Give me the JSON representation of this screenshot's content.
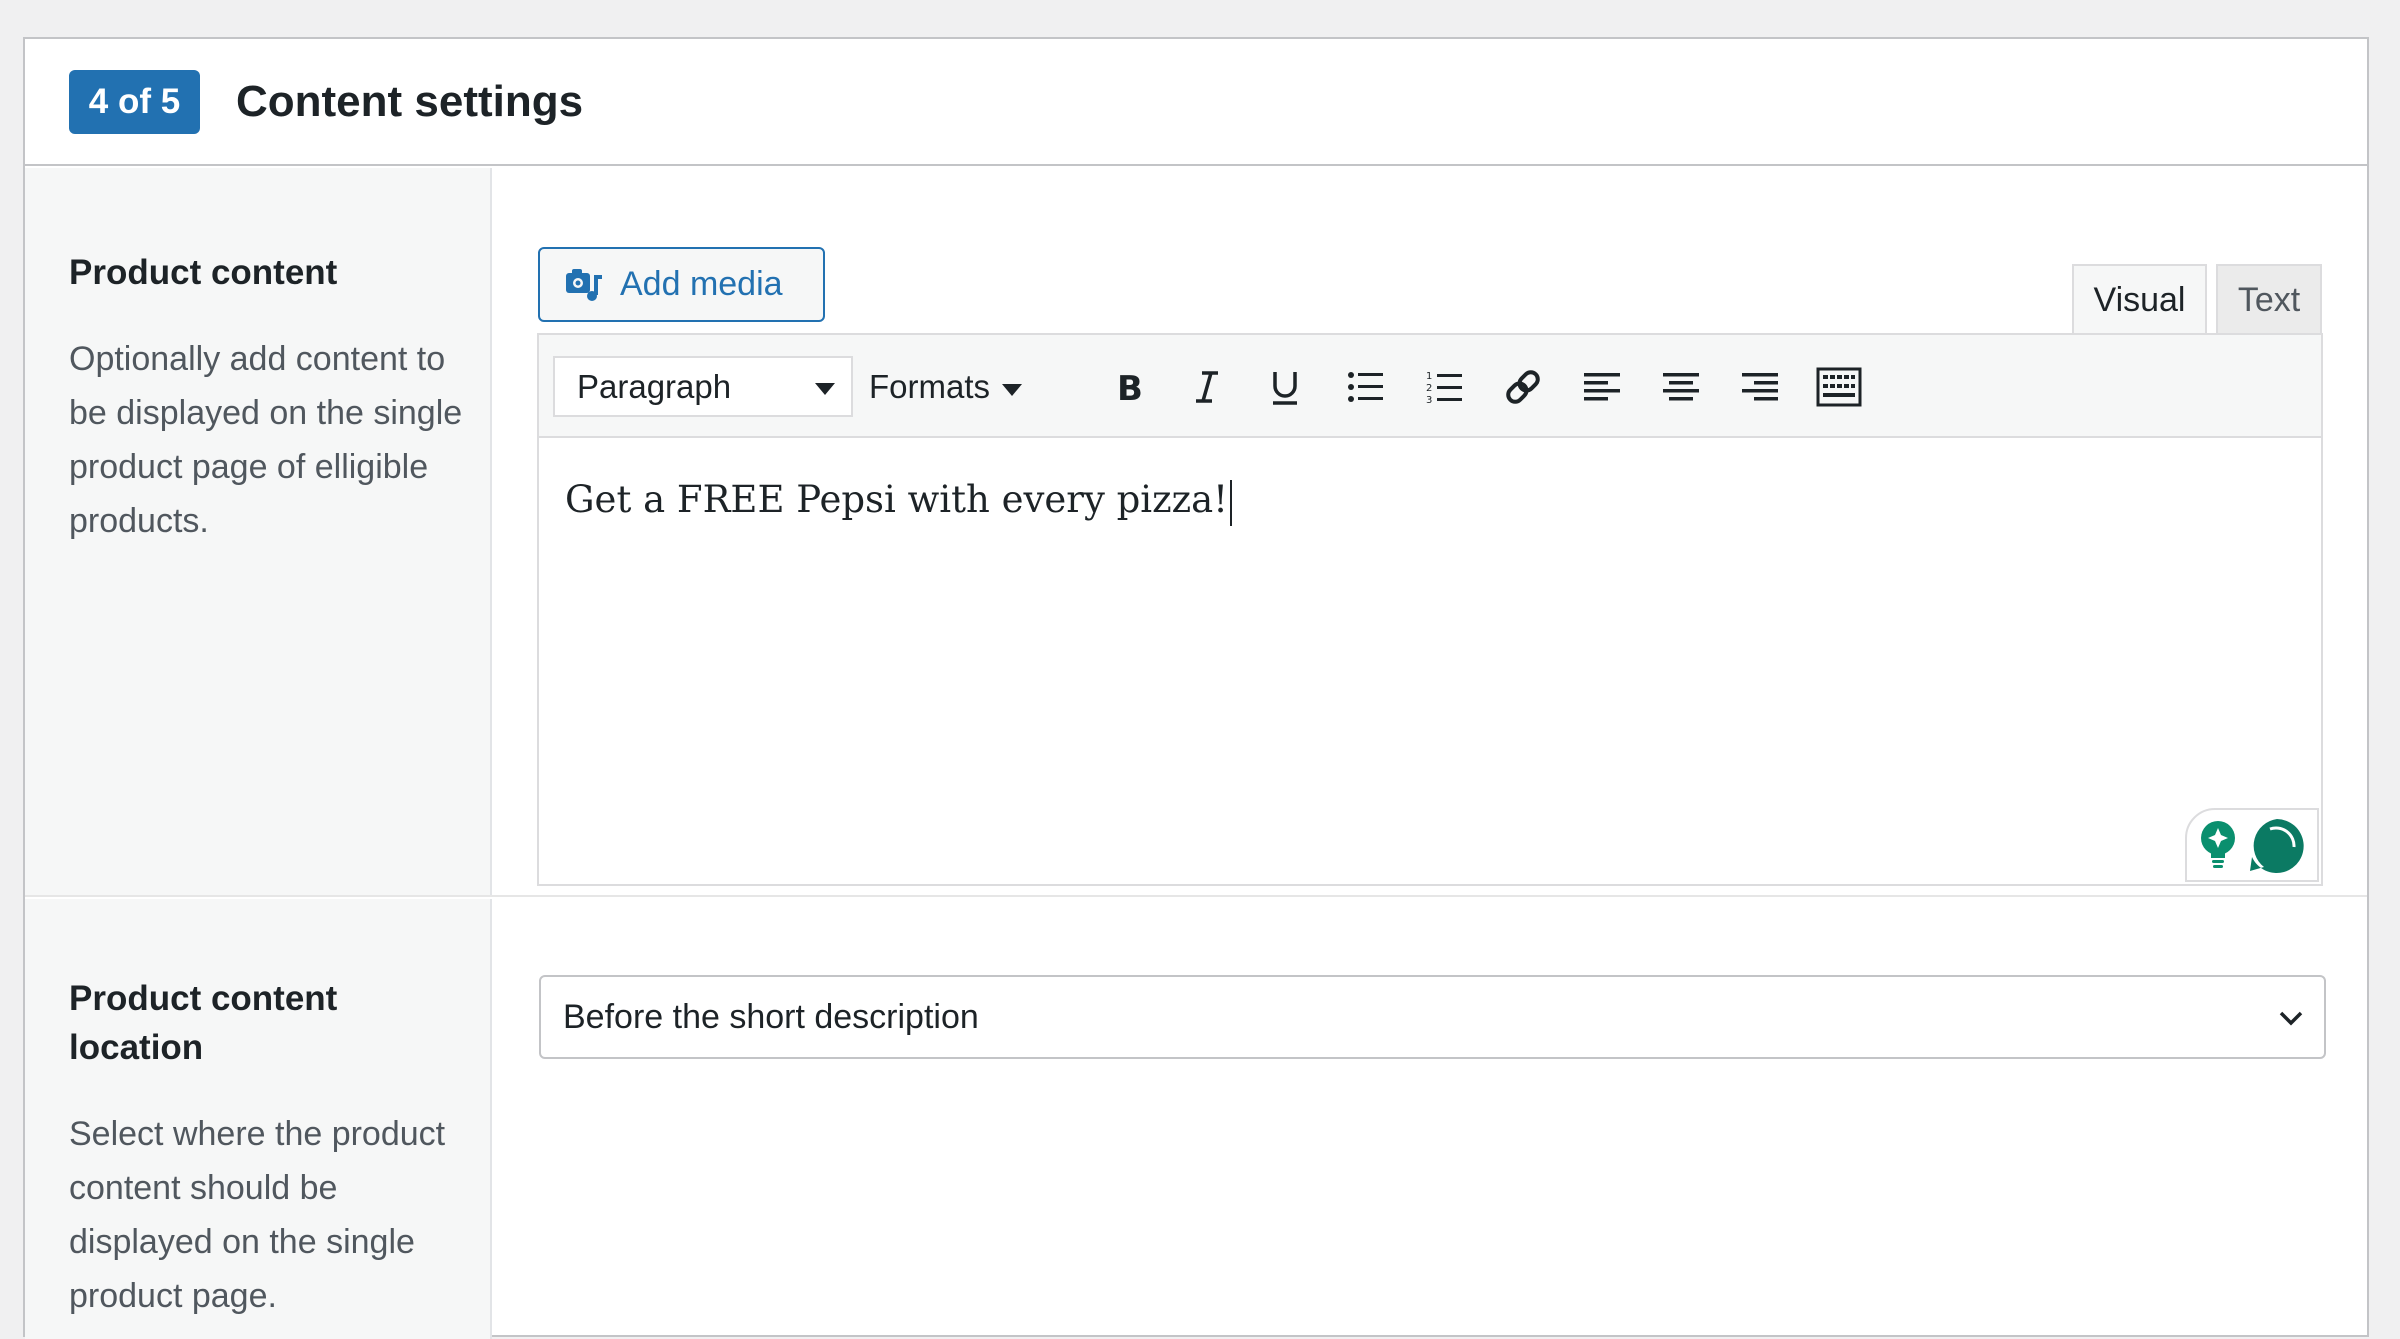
{
  "header": {
    "step_badge": "4 of 5",
    "title": "Content settings"
  },
  "product_content": {
    "label": "Product content",
    "description": "Optionally add content to be displayed on the single product page of elligible products.",
    "add_media_label": "Add media",
    "tabs": [
      {
        "label": "Visual",
        "active": true
      },
      {
        "label": "Text",
        "active": false
      }
    ],
    "toolbar": {
      "block_format": "Paragraph",
      "formats_label": "Formats",
      "buttons": [
        "bold-icon",
        "italic-icon",
        "underline-icon",
        "bulleted-list-icon",
        "numbered-list-icon",
        "link-icon",
        "align-left-icon",
        "align-center-icon",
        "align-right-icon",
        "toolbar-toggle-icon"
      ]
    },
    "content_text": "Get a FREE Pepsi with every pizza!",
    "assistant_icons": [
      "lightbulb-icon",
      "chat-bubble-icon"
    ]
  },
  "product_content_location": {
    "label": "Product content location",
    "description": "Select where the product content should be displayed on the single product page.",
    "selected_option": "Before the short description"
  },
  "colors": {
    "accent": "#2271b1",
    "assistant_green": "#0a8f6e",
    "assistant_teal": "#0b7a63"
  }
}
